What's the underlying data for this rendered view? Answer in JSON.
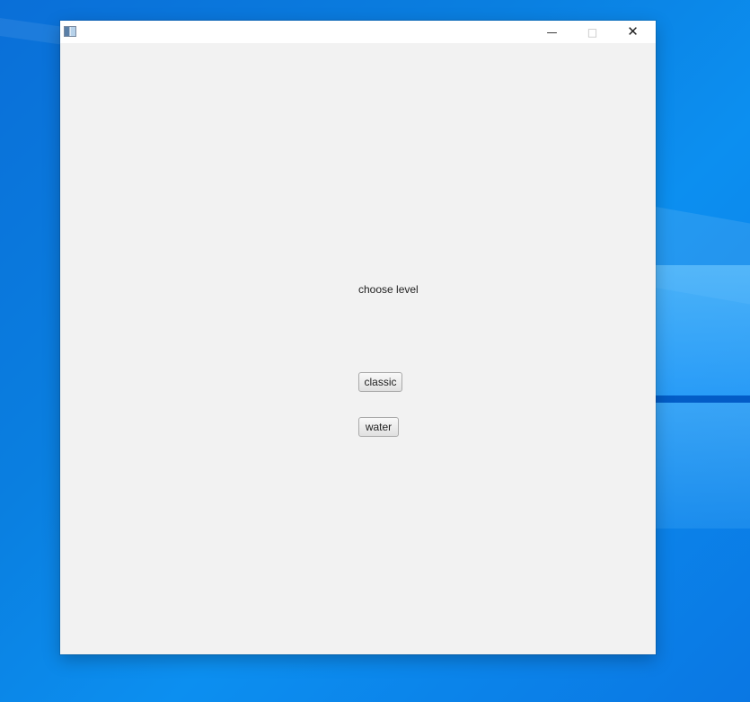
{
  "window": {
    "title": "",
    "controls": {
      "minimize_icon": "minimize-icon",
      "maximize_icon": "maximize-icon",
      "close_icon": "close-icon",
      "minimize_glyph": "—",
      "maximize_glyph": "□",
      "close_glyph": "✕"
    }
  },
  "main": {
    "prompt": "choose level",
    "buttons": [
      {
        "label": "classic"
      },
      {
        "label": "water"
      }
    ]
  },
  "colors": {
    "desktop_blue": "#0a7fe0",
    "window_bg": "#f2f2f2",
    "titlebar_bg": "#ffffff"
  }
}
